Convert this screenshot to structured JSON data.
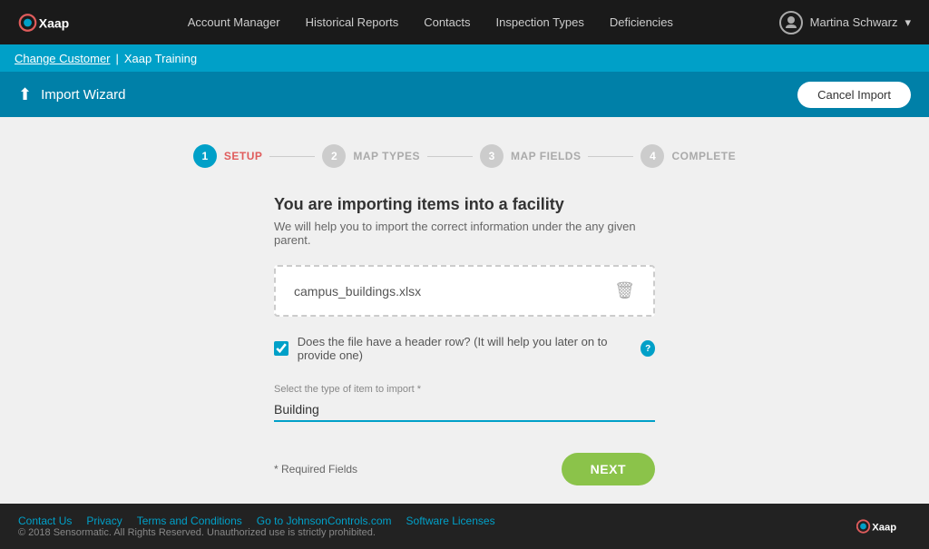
{
  "brand": {
    "name": "Xaap"
  },
  "topNav": {
    "links": [
      {
        "label": "Account Manager",
        "id": "account-manager"
      },
      {
        "label": "Historical Reports",
        "id": "historical-reports"
      },
      {
        "label": "Contacts",
        "id": "contacts"
      },
      {
        "label": "Inspection Types",
        "id": "inspection-types"
      },
      {
        "label": "Deficiencies",
        "id": "deficiencies"
      }
    ],
    "user": {
      "name": "Martina Schwarz",
      "chevron": "▾"
    }
  },
  "breadcrumb": {
    "link": "Change Customer",
    "separator": "|",
    "current": "Xaap Training"
  },
  "subHeader": {
    "title": "Import Wizard",
    "cancelLabel": "Cancel Import"
  },
  "stepper": {
    "steps": [
      {
        "number": "1",
        "label": "SETUP",
        "active": true
      },
      {
        "number": "2",
        "label": "MAP TYPES",
        "active": false
      },
      {
        "number": "3",
        "label": "MAP FIELDS",
        "active": false
      },
      {
        "number": "4",
        "label": "COMPLETE",
        "active": false
      }
    ]
  },
  "form": {
    "title": "You are importing items into a facility",
    "subtitle": "We will help you to import the correct information under the any given parent.",
    "fileName": "campus_buildings.xlsx",
    "deleteIconLabel": "🗑",
    "checkboxLabel": "Does the file have a header row? (It will help you later on to provide one)",
    "checkboxChecked": true,
    "selectLabel": "Select the type of item to import *",
    "selectValue": "Building",
    "requiredNote": "* Required Fields",
    "nextLabel": "NEXT"
  },
  "footer": {
    "links": [
      {
        "label": "Contact Us"
      },
      {
        "label": "Privacy"
      },
      {
        "label": "Terms and Conditions"
      },
      {
        "label": "Go to JohnsonControls.com"
      },
      {
        "label": "Software Licenses"
      }
    ],
    "copyright": "© 2018 Sensormatic. All Rights Reserved. Unauthorized use is strictly prohibited."
  }
}
